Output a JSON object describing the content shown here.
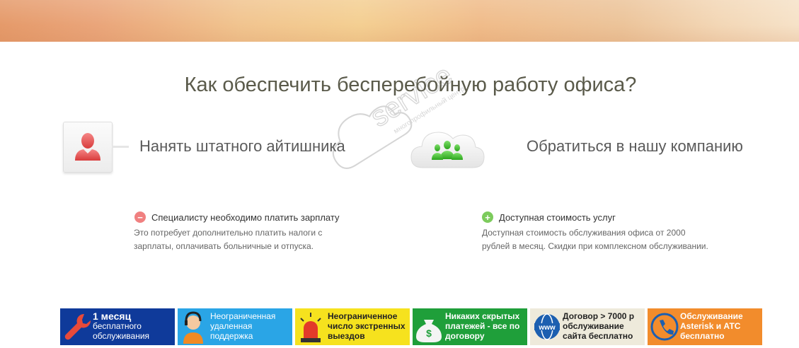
{
  "heading": "Как обеспечить бесперебойную работу офиса?",
  "options": {
    "left": {
      "label": "Нанять штатного айтишника",
      "icon": "person-icon"
    },
    "right": {
      "label": "Обратиться в нашу компанию",
      "icon": "cloud-team-icon"
    }
  },
  "points": {
    "minus": {
      "title": "Специалисту необходимо платить зарплату",
      "line1": "Это потребует дополнительно платить налоги с",
      "line2": "зарплаты, оплачивать больничные и отпуска.",
      "icon": "minus-icon",
      "color": "#f08080"
    },
    "plus": {
      "title": "Доступная стоимость услуг",
      "line1": "Доступная стоимость обслуживания офиса от 2000",
      "line2": "рублей в месяц. Скидки при комплексном обслуживании.",
      "icon": "plus-icon",
      "color": "#7ccb5c"
    }
  },
  "watermark": {
    "brand": "service",
    "tagline": "многопрофильный центр"
  },
  "features": [
    {
      "l1": "1 месяц",
      "l2": "бесплатного",
      "l3": "обслуживания",
      "bg": "#0f3a9a",
      "fg": "#ffffff",
      "icon": "wrench-icon"
    },
    {
      "l1": "Неограниченная",
      "l2": "удаленная",
      "l3": "поддержка",
      "bg": "#2aa5e6",
      "fg": "#ffffff",
      "icon": "support-agent-icon"
    },
    {
      "l1": "Неограниченное",
      "l2": "число экстренных",
      "l3": "выездов",
      "bg": "#f6e21e",
      "fg": "#222222",
      "icon": "siren-icon"
    },
    {
      "l1": "Никаких скрытых",
      "l2": "платежей - все по",
      "l3": "договору",
      "bg": "#1f9f3a",
      "fg": "#ffffff",
      "icon": "money-bag-icon"
    },
    {
      "l1": "Договор > 7000 р",
      "l2": "обслуживание",
      "l3": "сайта бесплатно",
      "bg": "#eeeadb",
      "fg": "#222222",
      "icon": "www-globe-icon"
    },
    {
      "l1": "Обслуживание",
      "l2": "Asterisk и АТС",
      "l3": "бесплатно",
      "bg": "#f28c2c",
      "fg": "#ffffff",
      "icon": "phone-icon"
    }
  ]
}
